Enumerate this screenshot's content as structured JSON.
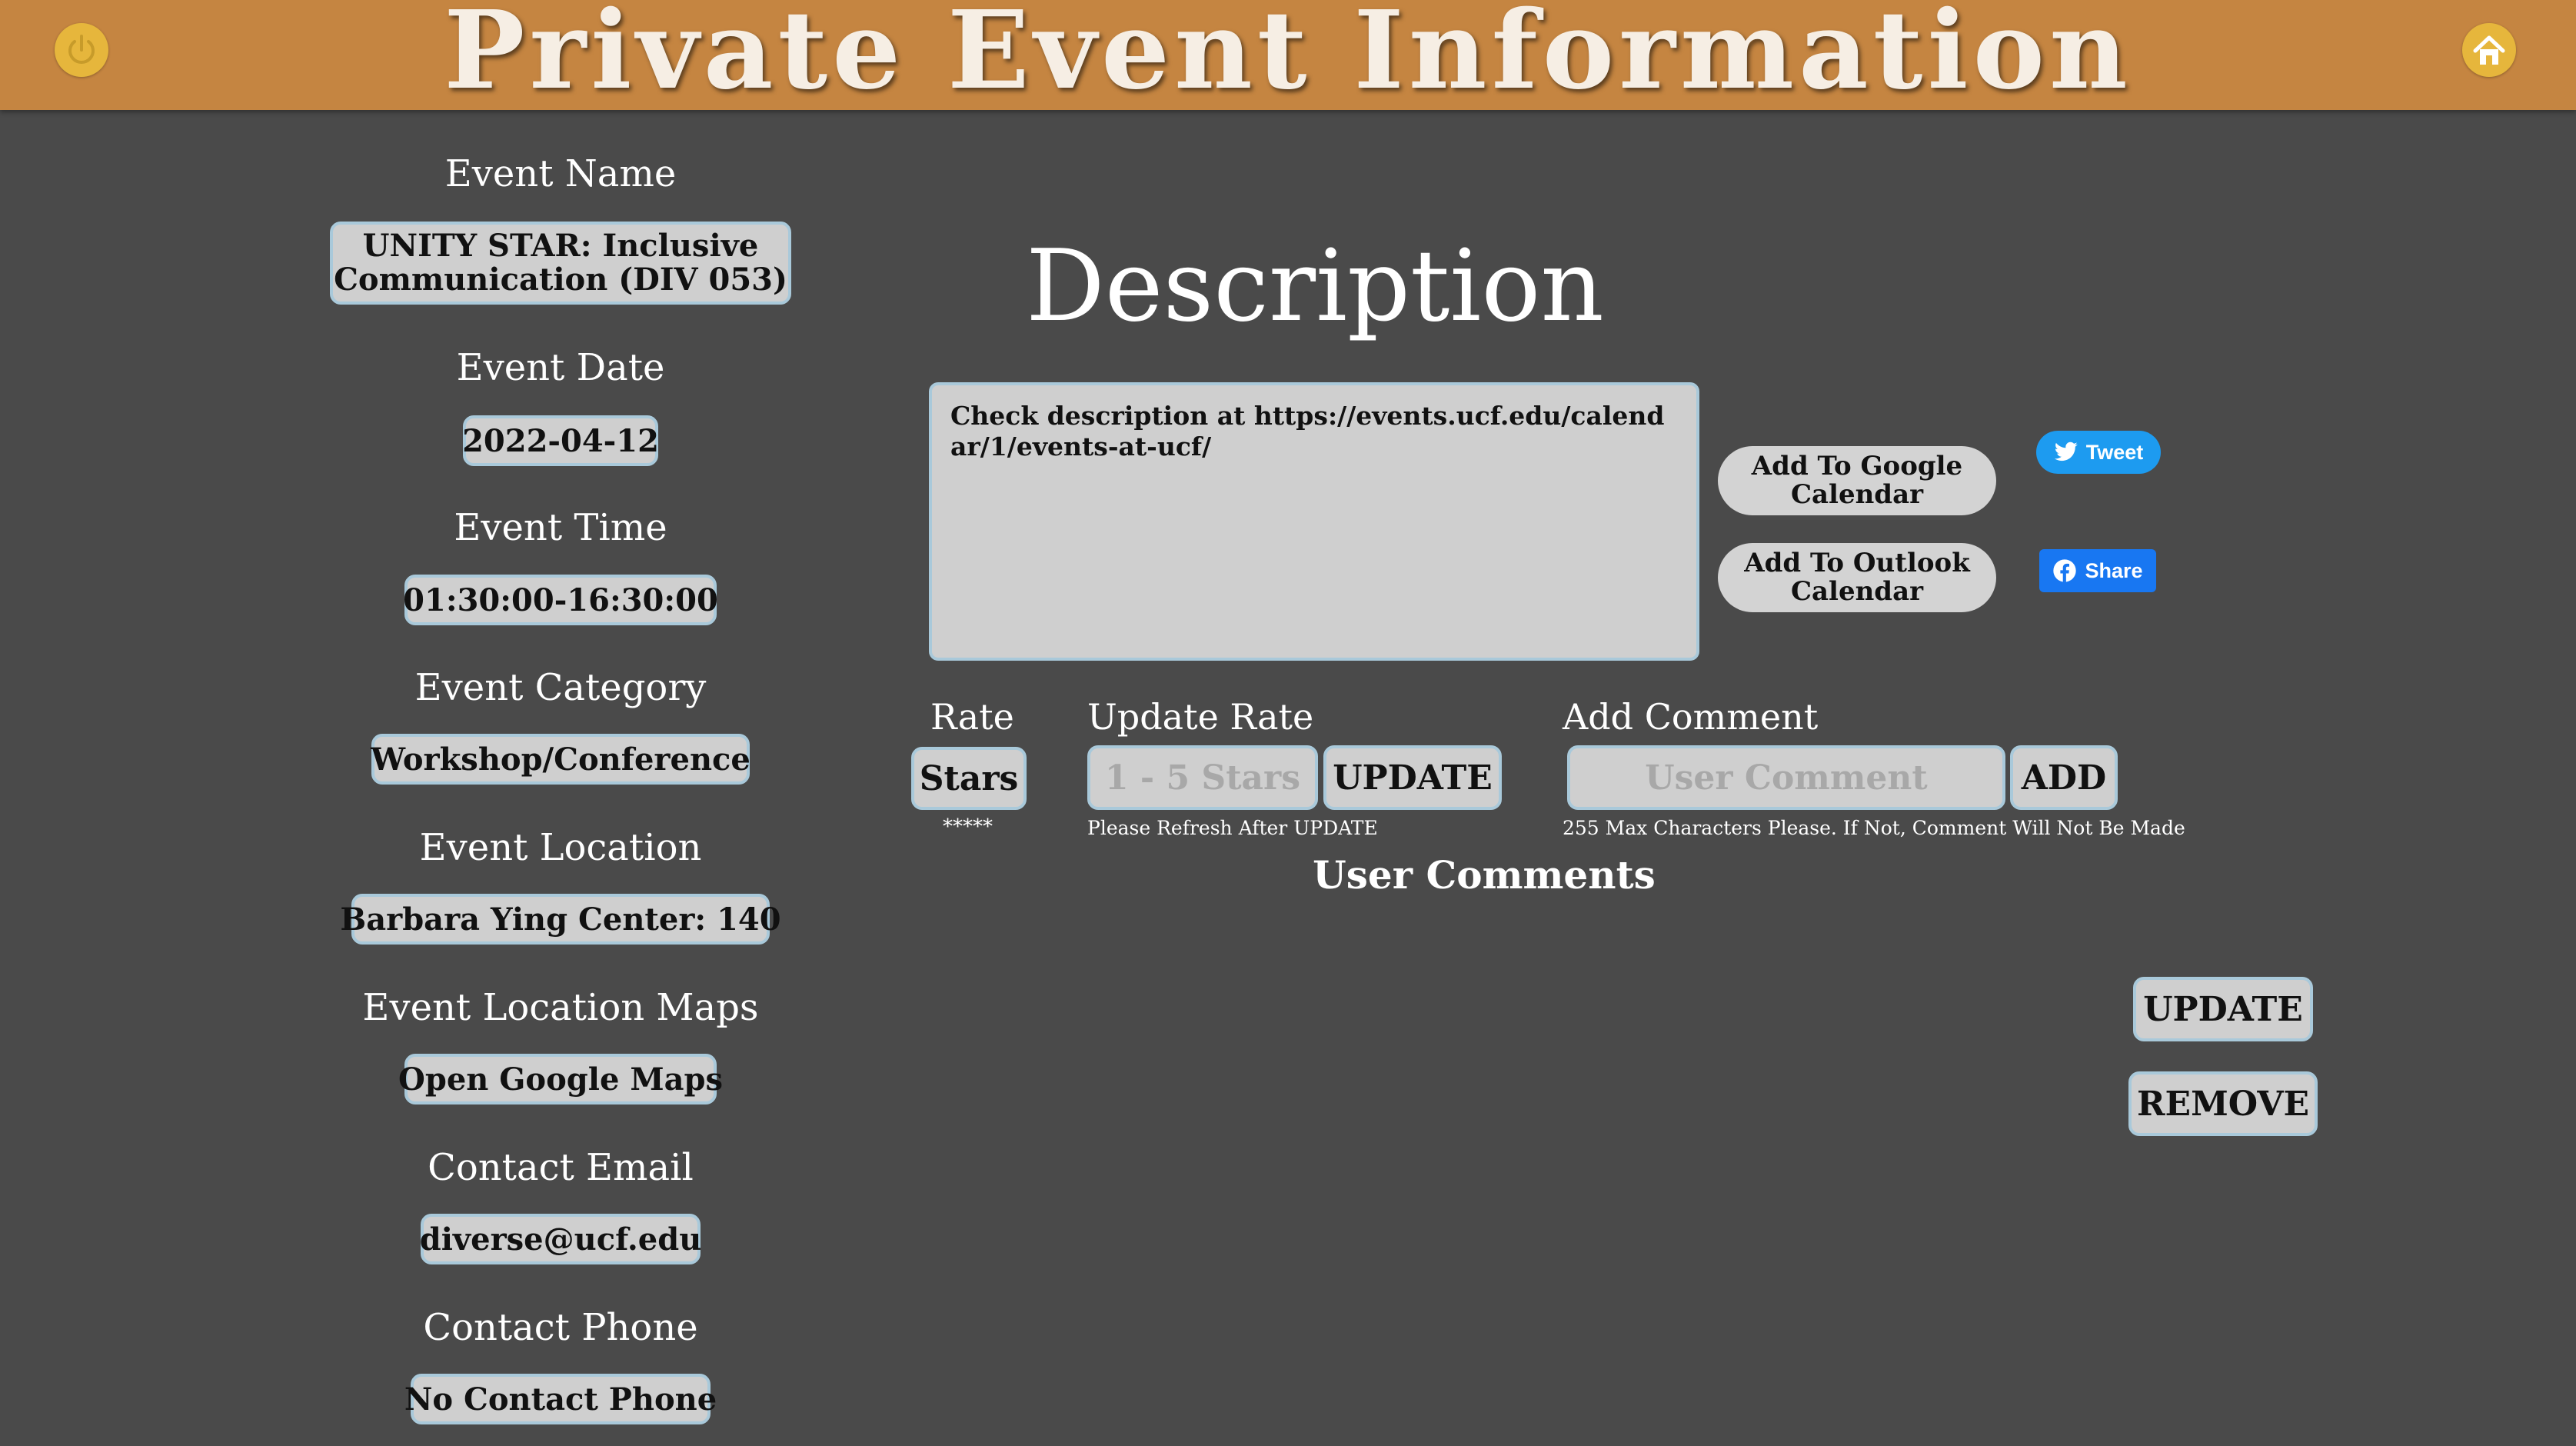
{
  "header": {
    "title": "Private Event Information",
    "left_icon": "power-icon",
    "right_icon": "home-icon",
    "icon_color": "#e6b63c",
    "bar_color": "#c58541"
  },
  "event": {
    "name_label": "Event Name",
    "name_value": "UNITY STAR: Inclusive Communication (DIV 053)",
    "date_label": "Event Date",
    "date_value": "2022-04-12",
    "time_label": "Event Time",
    "time_value": "01:30:00-16:30:00",
    "category_label": "Event Category",
    "category_value": "Workshop/Conference",
    "location_label": "Event Location",
    "location_value": "Barbara Ying Center: 140",
    "maps_label": "Event Location Maps",
    "maps_value": "Open Google Maps",
    "email_label": "Contact Email",
    "email_value": "diverse@ucf.edu",
    "phone_label": "Contact Phone",
    "phone_value": "No Contact Phone"
  },
  "description": {
    "title": "Description",
    "text": "Check description at https://events.ucf.edu/calendar/1/events-at-ucf/"
  },
  "calendar": {
    "google": "Add To Google Calendar",
    "outlook": "Add To Outlook Calendar"
  },
  "social": {
    "tweet": "Tweet",
    "share": "Share",
    "tweet_color": "#1d9bf0",
    "share_color": "#1877f2"
  },
  "rating": {
    "rate_label": "Rate",
    "stars_button": "Stars",
    "stars_display": "*****",
    "update_rate_label": "Update Rate",
    "rate_placeholder": "1 - 5 Stars",
    "update_button": "UPDATE",
    "refresh_note": "Please Refresh After UPDATE"
  },
  "comment": {
    "add_label": "Add Comment",
    "placeholder": "User Comment",
    "add_button": "ADD",
    "limit_note": "255 Max Characters Please. If Not, Comment Will Not Be Made"
  },
  "comments": {
    "title": "User Comments",
    "update_button": "UPDATE",
    "remove_button": "REMOVE"
  }
}
